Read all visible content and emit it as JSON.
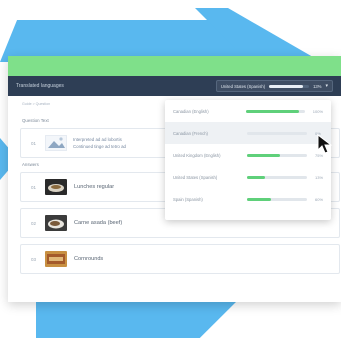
{
  "header": {
    "title": "Translated languages",
    "language_selector": {
      "label": "United States (Spanish)",
      "percent": "13%",
      "fill": 0.85
    }
  },
  "breadcrumb": "Guide > Question",
  "question_section": {
    "label": "Question Text",
    "number": "01",
    "text_line1": "Interpreted ad ad lobortis",
    "text_line2": "Continued tinge ad tetro ad"
  },
  "answers_section": {
    "label": "Answers",
    "items": [
      {
        "number": "01",
        "label": "Lunches regular"
      },
      {
        "number": "02",
        "label": "Carne asada (beef)"
      },
      {
        "number": "03",
        "label": "Cornrounds"
      }
    ]
  },
  "dropdown": {
    "items": [
      {
        "name": "Canadian (English)",
        "fill": 0.9,
        "percent": "100%"
      },
      {
        "name": "Canadian (French)",
        "fill": 0.0,
        "percent": "0%"
      },
      {
        "name": "United Kingdom (English)",
        "fill": 0.55,
        "percent": "75%"
      },
      {
        "name": "United States (Spanish)",
        "fill": 0.3,
        "percent": "13%"
      },
      {
        "name": "Spain (Spanish)",
        "fill": 0.4,
        "percent": "60%"
      }
    ]
  },
  "colors": {
    "accent": "#7fe08a",
    "header": "#2e3e55",
    "background_shape": "#59b8ef",
    "progress": "#5fd07a"
  }
}
